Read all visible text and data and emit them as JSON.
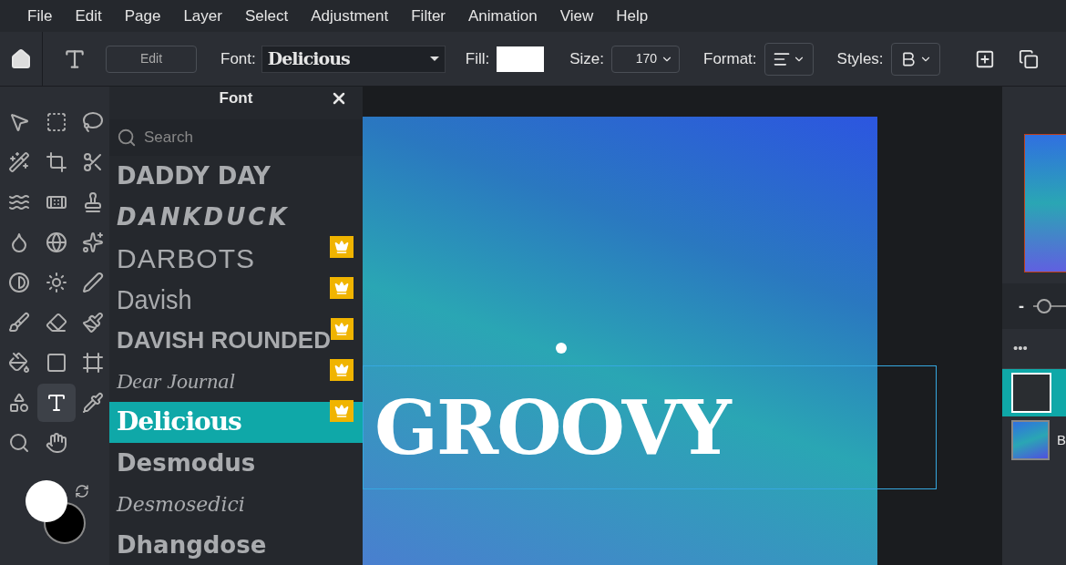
{
  "menu": [
    "File",
    "Edit",
    "Page",
    "Layer",
    "Select",
    "Adjustment",
    "Filter",
    "Animation",
    "View",
    "Help"
  ],
  "toolbar": {
    "edit_button": "Edit",
    "font_label": "Font:",
    "font_value": "Delicious",
    "fill_label": "Fill:",
    "size_label": "Size:",
    "size_value": "170",
    "format_label": "Format:",
    "styles_label": "Styles:"
  },
  "zoom_slider": {
    "level": 0.2
  },
  "tools": [
    {
      "selected": false
    },
    {
      "selected": false
    },
    {
      "selected": false
    },
    {
      "selected": false
    },
    {
      "selected": false
    },
    {
      "selected": false
    },
    {
      "selected": false
    },
    {
      "selected": false
    },
    {
      "selected": false
    },
    {
      "selected": false
    },
    {
      "selected": false
    },
    {
      "selected": false
    },
    {
      "selected": false
    },
    {
      "selected": false
    },
    {
      "selected": false
    },
    {
      "selected": false
    },
    {
      "selected": false
    },
    {
      "selected": false
    },
    {
      "selected": false
    },
    {
      "selected": false
    },
    {
      "selected": false
    },
    {
      "selected": false
    },
    {
      "selected": true
    },
    {
      "selected": false
    },
    {
      "selected": false
    },
    {
      "selected": false
    }
  ],
  "font_panel": {
    "title": "Font",
    "search": {
      "placeholder": "Search"
    },
    "fonts": [
      {
        "name": "DADDY DAY",
        "premium": false,
        "selected": false
      },
      {
        "name": "DANKDUCK",
        "premium": false,
        "selected": false
      },
      {
        "name": "DARBOTS",
        "premium": true,
        "selected": false
      },
      {
        "name": "Davish",
        "premium": true,
        "selected": false
      },
      {
        "name": "DAVISH ROUNDED",
        "premium": true,
        "selected": false
      },
      {
        "name": "Dear Journal",
        "premium": true,
        "selected": false
      },
      {
        "name": "Delicious",
        "premium": true,
        "selected": true
      },
      {
        "name": "Desmodus",
        "premium": false,
        "selected": false
      },
      {
        "name": "Desmosedici",
        "premium": false,
        "selected": false
      },
      {
        "name": "Dhangdose",
        "premium": false,
        "selected": false
      }
    ]
  },
  "canvas": {
    "text": "GROOVY"
  },
  "right_panel": {
    "zoom_minus": "-",
    "more": "•••",
    "layers": [
      {
        "selected": true
      },
      {
        "name": "B",
        "selected": false
      }
    ]
  }
}
